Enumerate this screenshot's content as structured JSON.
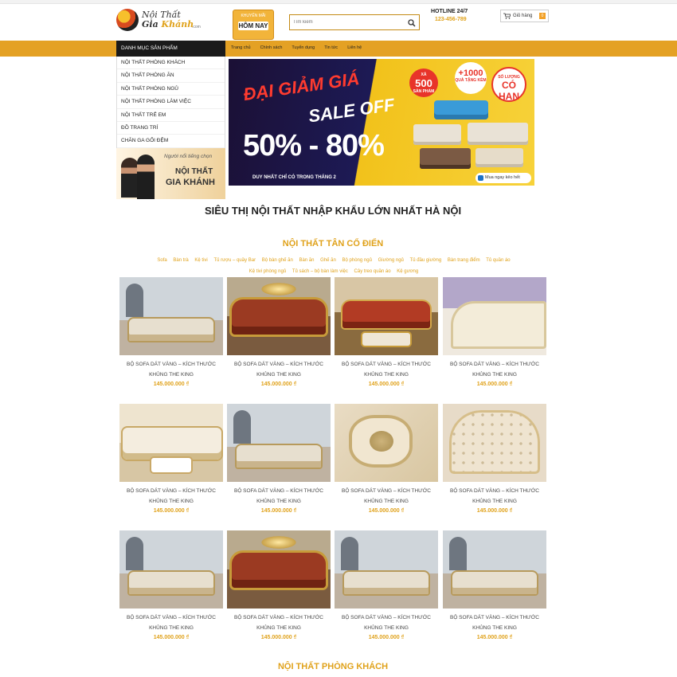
{
  "header": {
    "logo_line1": "Nội Thất",
    "logo_line2a": "Gia",
    "logo_line2b": "Khánh",
    "logo_domain": ".com",
    "promo_top": "KHUYẾN MÃI",
    "promo_main": "HÔM NAY",
    "search_placeholder": "Tìm kiếm",
    "hotline_label": "HOTLINE 24/7",
    "hotline_number": "123-456-789",
    "cart_label": "Giỏ hàng",
    "cart_count": "0"
  },
  "nav": {
    "category_header": "DANH MỤC SẢN PHẨM",
    "items": [
      "Trang chủ",
      "Chính sách",
      "Tuyển dụng",
      "Tin tức",
      "Liên hệ"
    ]
  },
  "categories": [
    "NỘI THẤT PHÒNG KHÁCH",
    "NỘI THẤT PHÒNG ĂN",
    "NỘI THẤT PHÒNG NGỦ",
    "NỘI THẤT PHÒNG LÀM VIỆC",
    "NỘI THẤT TRẺ EM",
    "ĐỒ TRANG TRÍ",
    "CHĂN GA GỐI ĐỆM"
  ],
  "side_banner": {
    "tagline": "Người nổi tiếng chọn",
    "brand1": "NỘI THẤT",
    "brand2": "GIA KHÁNH"
  },
  "slider": {
    "line1": "ĐẠI GIẢM GIÁ",
    "line2": "SALE OFF",
    "discount": "50% - 80%",
    "footnote": "DUY NHẤT CHỈ CÓ TRONG THÁNG 2",
    "badge1_top": "XẢ",
    "badge1_big": "500",
    "badge1_bottom": "SẢN PHẨM",
    "badge2_big": "+1000",
    "badge2_bottom": "QUÀ TẶNG KÈM",
    "badge3_top": "SỐ LƯỢNG",
    "badge3_big": "CÓ HẠN",
    "cta": "Mua ngay kẻo hết"
  },
  "main_title": "SIÊU THỊ NỘI THẤT NHẬP KHẨU LỚN NHẤT HÀ NỘI",
  "section1": {
    "title": "NỘI THẤT TÂN CỔ ĐIỂN",
    "subcats_row1": [
      "Sofa",
      "Bàn trà",
      "Kệ tivi",
      "Tủ rượu – quầy Bar",
      "Bộ bàn ghế ăn",
      "Bàn ăn",
      "Ghế ăn",
      "Bộ phòng ngủ",
      "Giường ngủ",
      "Tủ đầu giường",
      "Bàn trang điểm",
      "Tủ quần áo"
    ],
    "subcats_row2": [
      "Kệ tivi phòng ngủ",
      "Tủ sách – bộ bàn làm việc",
      "Cây treo quần áo",
      "Kệ gương"
    ]
  },
  "products": [
    {
      "name": "BỘ SOFA DÁT VÀNG – KÍCH THƯỚC KHỦNG THE KING",
      "price": "145.000.000 ₫",
      "style": "room"
    },
    {
      "name": "BỘ SOFA DÁT VÀNG – KÍCH THƯỚC KHỦNG THE KING",
      "price": "145.000.000 ₫",
      "style": "leather"
    },
    {
      "name": "BỘ SOFA DÁT VÀNG – KÍCH THƯỚC KHỦNG THE KING",
      "price": "145.000.000 ₫",
      "style": "living"
    },
    {
      "name": "BỘ SOFA DÁT VÀNG – KÍCH THƯỚC KHỦNG THE KING",
      "price": "145.000.000 ₫",
      "style": "closeup"
    },
    {
      "name": "BỘ SOFA DÁT VÀNG – KÍCH THƯỚC KHỦNG THE KING",
      "price": "145.000.000 ₫",
      "style": "cream"
    },
    {
      "name": "BỘ SOFA DÁT VÀNG – KÍCH THƯỚC KHỦNG THE KING",
      "price": "145.000.000 ₫",
      "style": "room"
    },
    {
      "name": "BỘ SOFA DÁT VÀNG – KÍCH THƯỚC KHỦNG THE KING",
      "price": "145.000.000 ₫",
      "style": "pillow"
    },
    {
      "name": "BỘ SOFA DÁT VÀNG – KÍCH THƯỚC KHỦNG THE KING",
      "price": "145.000.000 ₫",
      "style": "tufted"
    },
    {
      "name": "BỘ SOFA DÁT VÀNG – KÍCH THƯỚC KHỦNG THE KING",
      "price": "145.000.000 ₫",
      "style": "room"
    },
    {
      "name": "BỘ SOFA DÁT VÀNG – KÍCH THƯỚC KHỦNG THE KING",
      "price": "145.000.000 ₫",
      "style": "leather"
    },
    {
      "name": "BỘ SOFA DÁT VÀNG – KÍCH THƯỚC KHỦNG THE KING",
      "price": "145.000.000 ₫",
      "style": "room"
    },
    {
      "name": "BỘ SOFA DÁT VÀNG – KÍCH THƯỚC KHỦNG THE KING",
      "price": "145.000.000 ₫",
      "style": "room"
    }
  ],
  "section2": {
    "title": "NỘI THẤT PHÒNG KHÁCH"
  },
  "colors": {
    "accent": "#e4a124",
    "price": "#e0a21b",
    "dark": "#1a1a1a"
  },
  "icons": {
    "search": "search-icon",
    "cart": "cart-icon",
    "logo": "logo-mark-icon"
  }
}
